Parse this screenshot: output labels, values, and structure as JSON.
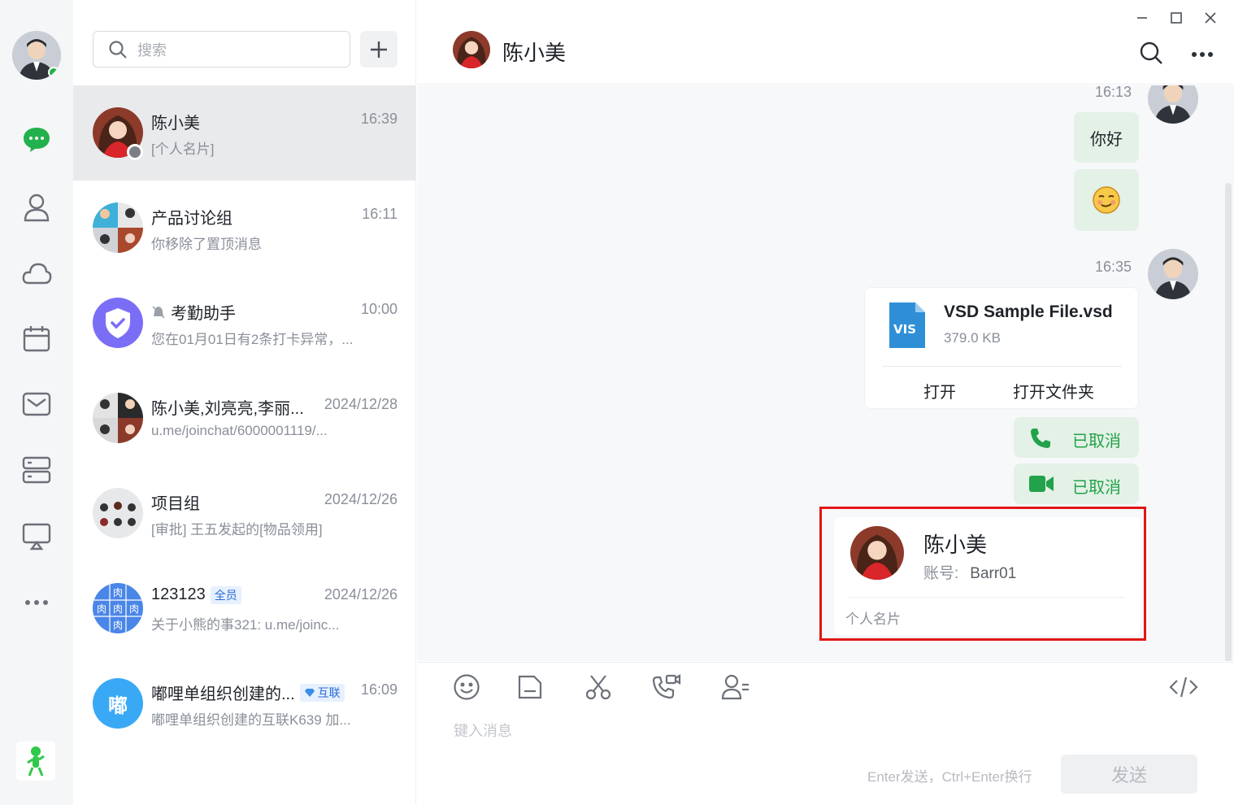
{
  "window": {
    "minimize": "minimize",
    "maximize": "maximize",
    "close": "close"
  },
  "search": {
    "placeholder": "搜索"
  },
  "conversations": [
    {
      "name": "陈小美",
      "time": "16:39",
      "preview": "[个人名片]"
    },
    {
      "name": "产品讨论组",
      "time": "16:11",
      "preview": "你移除了置顶消息"
    },
    {
      "name": "考勤助手",
      "time": "10:00",
      "preview": "您在01月01日有2条打卡异常，..."
    },
    {
      "name": "陈小美,刘亮亮,李丽...",
      "time": "2024/12/28",
      "preview": "u.me/joinchat/6000001119/..."
    },
    {
      "name": "项目组",
      "time": "2024/12/26",
      "preview": "[审批] 王五发起的[物品领用]"
    },
    {
      "name": "123123",
      "badge": "全员",
      "time": "2024/12/26",
      "preview": "关于小熊的事321: u.me/joinc..."
    },
    {
      "name": "嘟哩单组织创建的...",
      "badge": "互联",
      "time": "16:09",
      "preview": "嘟哩单组织创建的互联K639 加..."
    }
  ],
  "avatars": {
    "dudu_char": "嘟",
    "meat_char": "肉"
  },
  "chat": {
    "title": "陈小美",
    "messages": {
      "ts1": "16:13",
      "hello": "你好",
      "ts2": "16:35",
      "file": {
        "icon_label": "VIS",
        "name": "VSD Sample File.vsd",
        "size": "379.0 KB",
        "open": "打开",
        "open_folder": "打开文件夹"
      },
      "voice_call": "已取消",
      "video_call": "已取消",
      "contact_card": {
        "name": "陈小美",
        "account_label": "账号:",
        "account": "Barr01",
        "footer": "个人名片"
      }
    }
  },
  "composer": {
    "placeholder": "键入消息",
    "hint": "Enter发送，Ctrl+Enter换行",
    "send": "发送"
  },
  "colors": {
    "accent_green": "#22b14c",
    "highlight_red": "#e21616",
    "bubble_green": "#e3f1e6"
  }
}
